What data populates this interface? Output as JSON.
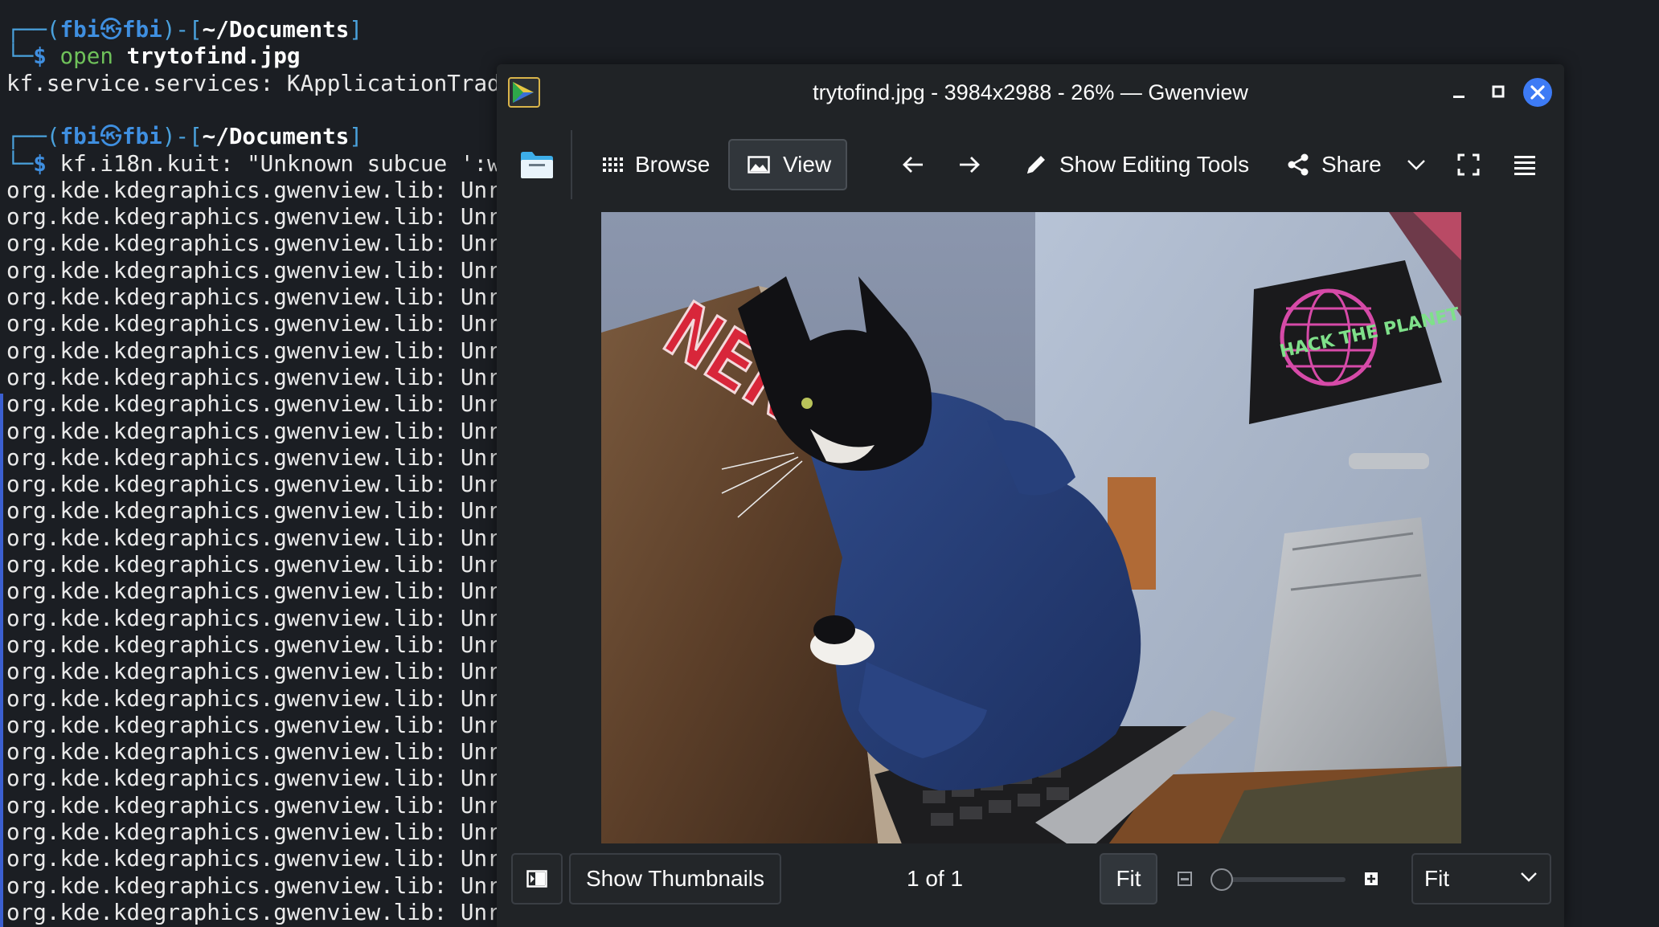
{
  "terminal": {
    "lines": [
      {
        "kind": "prompt",
        "box_top": "┌──(",
        "user": "fbi",
        "skull": "㉿",
        "host": "fbi",
        "mid": ")-[",
        "dir": "~/Documents",
        "end": "]"
      },
      {
        "kind": "command",
        "box_bottom": "└─",
        "dollar": "$",
        "cmd": "open",
        "arg": "trytofind.jpg"
      },
      {
        "kind": "text",
        "text": "kf.service.services: KApplicationTrad"
      },
      {
        "kind": "blank",
        "text": ""
      },
      {
        "kind": "prompt",
        "box_top": "┌──(",
        "user": "fbi",
        "skull": "㉿",
        "host": "fbi",
        "mid": ")-[",
        "dir": "~/Documents",
        "end": "]"
      },
      {
        "kind": "command",
        "box_bottom": "└─",
        "dollar": "$",
        "cmd": "kf.i18n.kuit: \"Unknown subcue ':w",
        "arg": ""
      },
      {
        "kind": "text",
        "text": "org.kde.kdegraphics.gwenview.lib: Unr"
      },
      {
        "kind": "text",
        "text": "org.kde.kdegraphics.gwenview.lib: Unr"
      },
      {
        "kind": "text",
        "text": "org.kde.kdegraphics.gwenview.lib: Unr"
      },
      {
        "kind": "text",
        "text": "org.kde.kdegraphics.gwenview.lib: Unr"
      },
      {
        "kind": "text",
        "text": "org.kde.kdegraphics.gwenview.lib: Unr"
      },
      {
        "kind": "text",
        "text": "org.kde.kdegraphics.gwenview.lib: Unr"
      },
      {
        "kind": "text",
        "text": "org.kde.kdegraphics.gwenview.lib: Unr"
      },
      {
        "kind": "text",
        "text": "org.kde.kdegraphics.gwenview.lib: Unr"
      },
      {
        "kind": "text",
        "text": "org.kde.kdegraphics.gwenview.lib: Unr"
      },
      {
        "kind": "text",
        "text": "org.kde.kdegraphics.gwenview.lib: Unr"
      },
      {
        "kind": "text",
        "text": "org.kde.kdegraphics.gwenview.lib: Unr"
      },
      {
        "kind": "text",
        "text": "org.kde.kdegraphics.gwenview.lib: Unr"
      },
      {
        "kind": "text",
        "text": "org.kde.kdegraphics.gwenview.lib: Unr"
      },
      {
        "kind": "text",
        "text": "org.kde.kdegraphics.gwenview.lib: Unr"
      },
      {
        "kind": "text",
        "text": "org.kde.kdegraphics.gwenview.lib: Unr"
      },
      {
        "kind": "text",
        "text": "org.kde.kdegraphics.gwenview.lib: Unr"
      },
      {
        "kind": "text",
        "text": "org.kde.kdegraphics.gwenview.lib: Unr"
      },
      {
        "kind": "text",
        "text": "org.kde.kdegraphics.gwenview.lib: Unr"
      },
      {
        "kind": "text",
        "text": "org.kde.kdegraphics.gwenview.lib: Unr"
      },
      {
        "kind": "text",
        "text": "org.kde.kdegraphics.gwenview.lib: Unr"
      },
      {
        "kind": "text",
        "text": "org.kde.kdegraphics.gwenview.lib: Unr"
      },
      {
        "kind": "text",
        "text": "org.kde.kdegraphics.gwenview.lib: Unr"
      },
      {
        "kind": "text",
        "text": "org.kde.kdegraphics.gwenview.lib: Unr"
      },
      {
        "kind": "text",
        "text": "org.kde.kdegraphics.gwenview.lib: Unr"
      },
      {
        "kind": "text",
        "text": "org.kde.kdegraphics.gwenview.lib: Unr"
      },
      {
        "kind": "text",
        "text": "org.kde.kdegraphics.gwenview.lib: Unr"
      },
      {
        "kind": "text",
        "text": "org.kde.kdegraphics.gwenview.lib: Unr"
      },
      {
        "kind": "text",
        "text": "org.kde.kdegraphics.gwenview.lib: Unr"
      }
    ]
  },
  "window": {
    "title": "trytofind.jpg - 3984x2988 - 26% — Gwenview",
    "app_icon": "gwenview-app-icon",
    "controls": {
      "minimize": "minimize-icon",
      "maximize": "maximize-icon",
      "close": "close-icon"
    },
    "close_color": "#3d7bf5"
  },
  "toolbar": {
    "sidebar_icon": "folder-sidebar-icon",
    "browse_label": "Browse",
    "view_label": "View",
    "back_icon": "arrow-left-icon",
    "forward_icon": "arrow-right-icon",
    "editing_label": "Show Editing Tools",
    "share_label": "Share",
    "fullscreen_icon": "fullscreen-icon",
    "menu_icon": "hamburger-menu-icon"
  },
  "photo": {
    "description_icons": [
      "cat-in-hoodie-photo"
    ],
    "laptop_sticker": "NERD",
    "poster_text": "HACK THE PLANET"
  },
  "statusbar": {
    "thumbnails_label": "Show Thumbnails",
    "page_counter": "1 of 1",
    "fit_label": "Fit",
    "zoom_select_value": "Fit",
    "zoom_slider_fraction": 0.0
  },
  "colors": {
    "window_bg": "#202326",
    "terminal_bg": "#1b1e23",
    "accent": "#3d7bf5"
  }
}
